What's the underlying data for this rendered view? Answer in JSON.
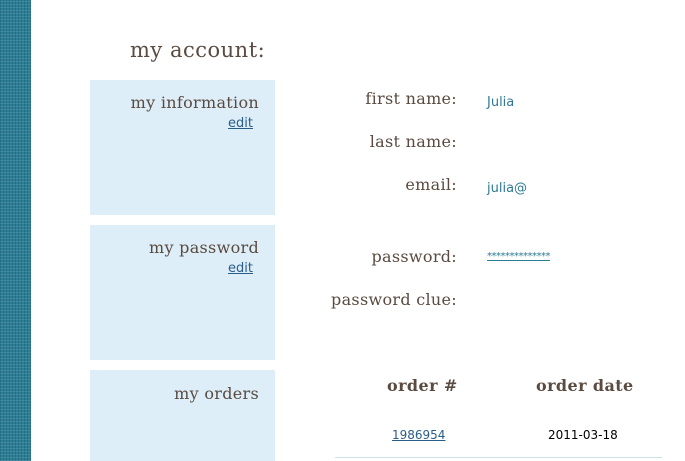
{
  "colors": {
    "accent": "#2f7b95",
    "box_bg": "#ddeef8",
    "heading": "#5a4a40",
    "stripe": "#2c7e95"
  },
  "page": {
    "title": "my account:"
  },
  "sections": {
    "information": {
      "title": "my information",
      "edit": "edit"
    },
    "password": {
      "title": "my password",
      "edit": "edit"
    },
    "orders": {
      "title": "my orders"
    }
  },
  "info_fields": {
    "first_name_label": "first name:",
    "first_name_value": "Julia",
    "last_name_label": "last name:",
    "last_name_value": "",
    "email_label": "email:",
    "email_value": "julia@"
  },
  "password_fields": {
    "password_label": "password:",
    "password_value": "**************",
    "clue_label": "password clue:",
    "clue_value": ""
  },
  "orders_table": {
    "columns": [
      "order #",
      "order date"
    ],
    "rows": [
      {
        "order_number": "1986954",
        "order_date": "2011-03-18"
      }
    ]
  }
}
